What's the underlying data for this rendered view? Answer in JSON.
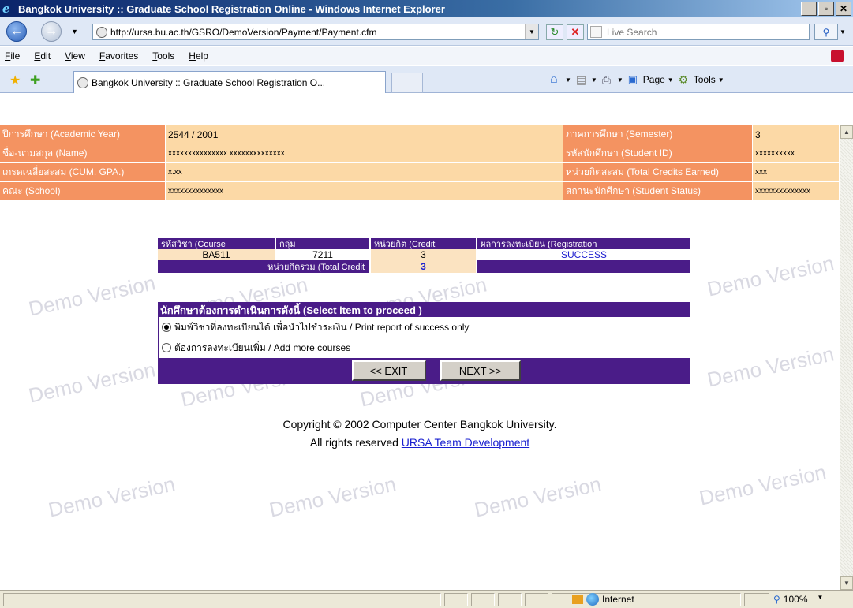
{
  "window": {
    "title": "Bangkok University :: Graduate School Registration Online - Windows Internet Explorer",
    "min": "_",
    "max": "▫",
    "close": "✕"
  },
  "address": {
    "url": "http://ursa.bu.ac.th/GSRO/DemoVersion/Payment/Payment.cfm",
    "search_placeholder": "Live Search"
  },
  "menu": [
    "File",
    "Edit",
    "View",
    "Favorites",
    "Tools",
    "Help"
  ],
  "tab": {
    "label": "Bangkok University :: Graduate School Registration O...",
    "page_label": "Page",
    "tools_label": "Tools"
  },
  "info": {
    "rows": [
      {
        "l1": "ปีการศึกษา (Academic Year)",
        "v1": "2544 / 2001",
        "l2": "ภาคการศึกษา (Semester)",
        "v2": "3"
      },
      {
        "l1": "ชื่อ-นามสกุล (Name)",
        "v1": "xxxxxxxxxxxxxxx xxxxxxxxxxxxxx",
        "l2": "รหัสนักศึกษา (Student ID)",
        "v2": "xxxxxxxxxx"
      },
      {
        "l1": "เกรดเฉลี่ยสะสม (CUM. GPA.)",
        "v1": "x.xx",
        "l2": "หน่วยกิตสะสม (Total Credits Earned)",
        "v2": "xxx"
      },
      {
        "l1": "คณะ (School)",
        "v1": "xxxxxxxxxxxxxx",
        "l2": "สถานะนักศึกษา (Student Status)",
        "v2": "xxxxxxxxxxxxxx"
      }
    ]
  },
  "course": {
    "headers": [
      "รหัสวิชา (Course",
      "กลุ่ม",
      "หน่วยกิต (Credit",
      "ผลการลงทะเบียน (Registration"
    ],
    "rows": [
      {
        "code": "BA511",
        "group": "7211",
        "credit": "3",
        "result": "SUCCESS"
      }
    ],
    "total_label": "หน่วยกิตรวม (Total Credit",
    "total_value": "3"
  },
  "select": {
    "header": "นักศึกษาต้องการดำเนินการดังนี้ (Select item to proceed )",
    "options": [
      {
        "label": "พิมพ์วิชาที่ลงทะเบียนได้ เพื่อนำไปชำระเงิน / Print report of success only",
        "selected": true
      },
      {
        "label": "ต้องการลงทะเบียนเพิ่ม / Add more courses",
        "selected": false
      }
    ],
    "exit_label": "<< EXIT",
    "next_label": "NEXT >>"
  },
  "footer": {
    "line1": "Copyright © 2002 Computer Center Bangkok University.",
    "line2_prefix": "All rights reserved ",
    "link": "URSA Team Development"
  },
  "watermark": "Demo Version",
  "status": {
    "zone": "Internet",
    "zoom": "100%"
  },
  "colors": {
    "label_bg": "#f49361",
    "value_bg": "#fcd9a6",
    "purple": "#4a1c88",
    "success": "#2020d0"
  }
}
